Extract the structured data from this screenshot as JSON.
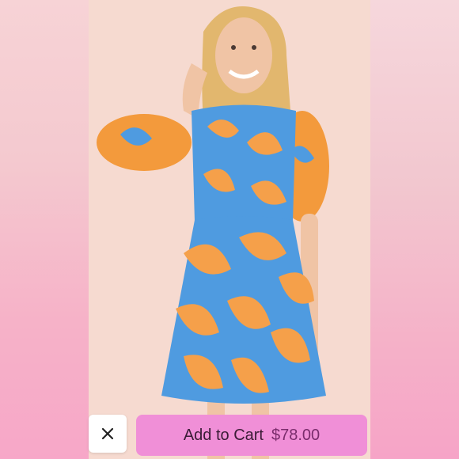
{
  "listing": {
    "image_alt": "Orange and blue floral print puff sleeve mini dress"
  },
  "cart_bar": {
    "close_icon": "close-icon",
    "add_label": "Add to Cart",
    "price": "$78.00",
    "accent": "#f08fd7"
  }
}
